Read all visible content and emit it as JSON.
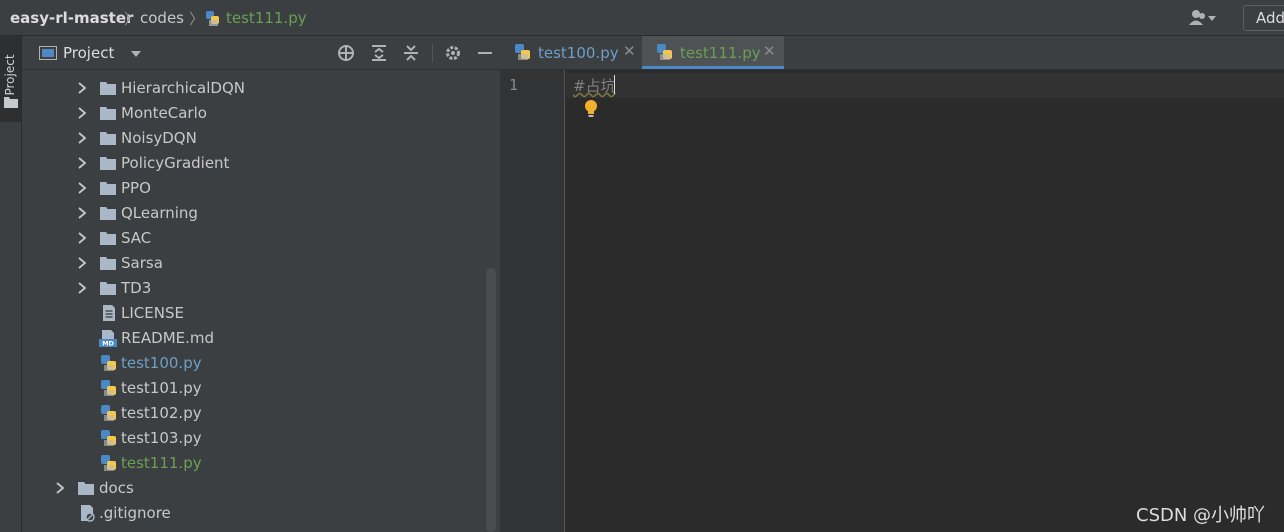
{
  "breadcrumb": {
    "project": "easy-rl-master",
    "folder": "codes",
    "file": "test111.py"
  },
  "toolbar": {
    "add_label": "Add",
    "user_icon": "user-icon"
  },
  "side_strip": {
    "tab_label": "Project"
  },
  "project_panel": {
    "title": "Project",
    "tools": [
      "locate-icon",
      "expand-all-icon",
      "collapse-all-icon",
      "gear-icon",
      "minimize-icon"
    ]
  },
  "tree": {
    "items": [
      {
        "label": "HierarchicalDQN",
        "type": "folder"
      },
      {
        "label": "MonteCarlo",
        "type": "folder"
      },
      {
        "label": "NoisyDQN",
        "type": "folder"
      },
      {
        "label": "PolicyGradient",
        "type": "folder"
      },
      {
        "label": "PPO",
        "type": "folder"
      },
      {
        "label": "QLearning",
        "type": "folder"
      },
      {
        "label": "SAC",
        "type": "folder"
      },
      {
        "label": "Sarsa",
        "type": "folder"
      },
      {
        "label": "TD3",
        "type": "folder"
      },
      {
        "label": "LICENSE",
        "type": "text-file"
      },
      {
        "label": "README.md",
        "type": "markdown-file"
      },
      {
        "label": "test100.py",
        "type": "python-file"
      },
      {
        "label": "test101.py",
        "type": "python-file"
      },
      {
        "label": "test102.py",
        "type": "python-file"
      },
      {
        "label": "test103.py",
        "type": "python-file"
      },
      {
        "label": "test111.py",
        "type": "python-file"
      },
      {
        "label": "docs",
        "type": "folder"
      },
      {
        "label": ".gitignore",
        "type": "ignore-file"
      }
    ]
  },
  "editor": {
    "tabs": [
      {
        "label": "test100.py",
        "active": false
      },
      {
        "label": "test111.py",
        "active": true
      }
    ],
    "line_number": "1",
    "code_line": "#占坑"
  },
  "watermark": "CSDN @小帅吖",
  "colors": {
    "accent": "#4a88c7",
    "modified_file": "#6d9fc8",
    "new_file": "#6a9f55",
    "bulb": "#f2b02c"
  }
}
